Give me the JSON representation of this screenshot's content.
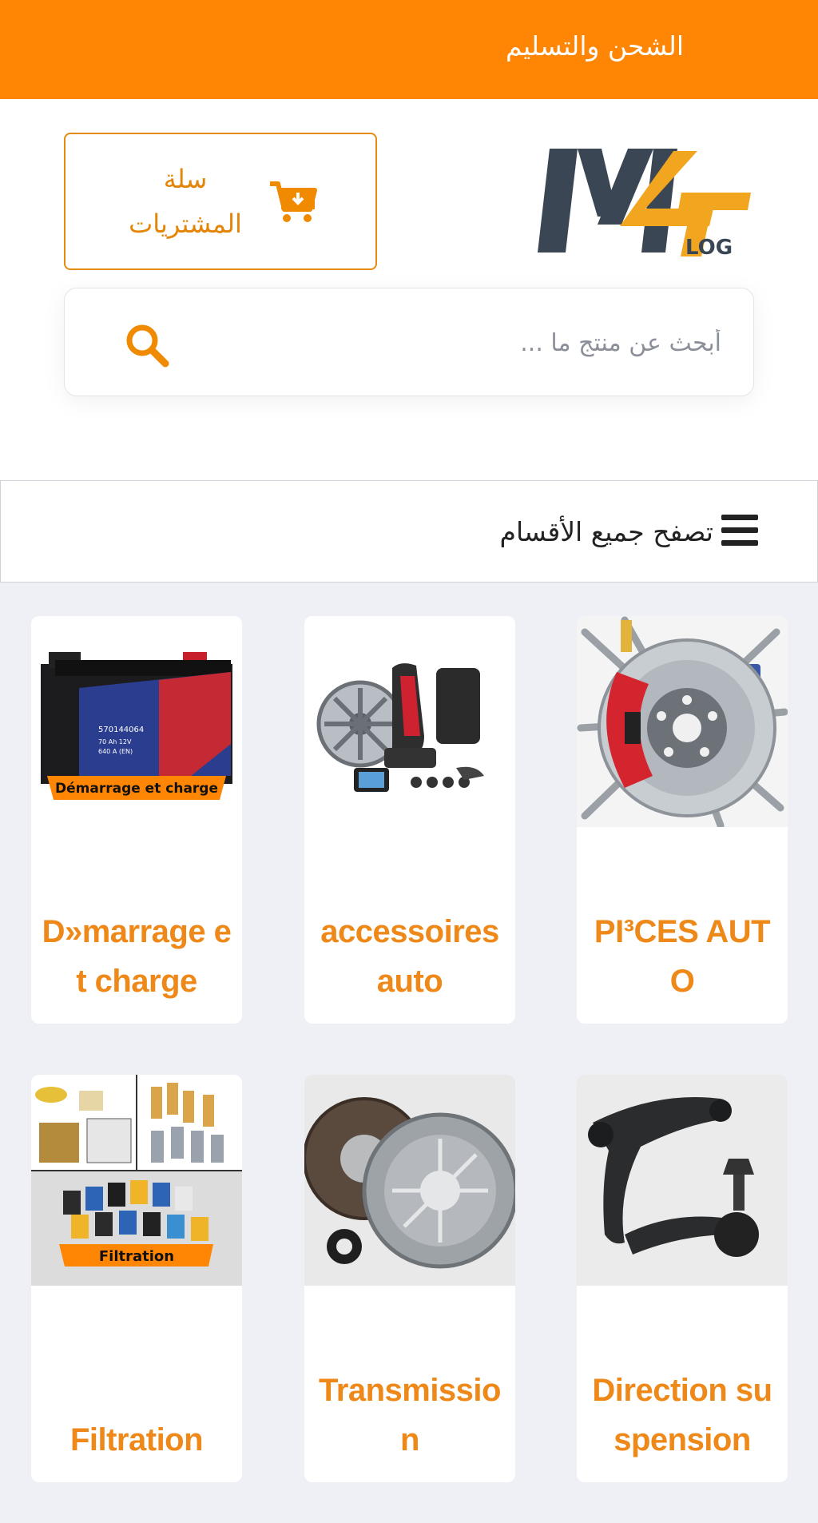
{
  "topbar": {
    "link": "الشحن والتسليم"
  },
  "logo": {
    "letters": "M4",
    "suffix": "LOG"
  },
  "cart": {
    "label": "سلة المشتريات"
  },
  "search": {
    "placeholder": "أبحث عن منتج ما ..."
  },
  "browse": {
    "label": "تصفح جميع الأقسام"
  },
  "categories": [
    {
      "title": "PI³CES AUTO",
      "image": "brake-disc-parts"
    },
    {
      "title": "accessoires auto",
      "image": "accessories"
    },
    {
      "title": "D»marrage et charge",
      "image": "battery",
      "banner": "Démarrage et charge",
      "battery_code": "570144064",
      "battery_spec1": "70 Ah 12V",
      "battery_spec2": "640 A (EN)"
    },
    {
      "title": "Direction suspension",
      "image": "control-arm"
    },
    {
      "title": "Transmission",
      "image": "clutch"
    },
    {
      "title": "Filtration",
      "image": "filters",
      "banner": "Filtration"
    }
  ],
  "colors": {
    "accent": "#ff8505",
    "text_orange": "#ee8818"
  }
}
